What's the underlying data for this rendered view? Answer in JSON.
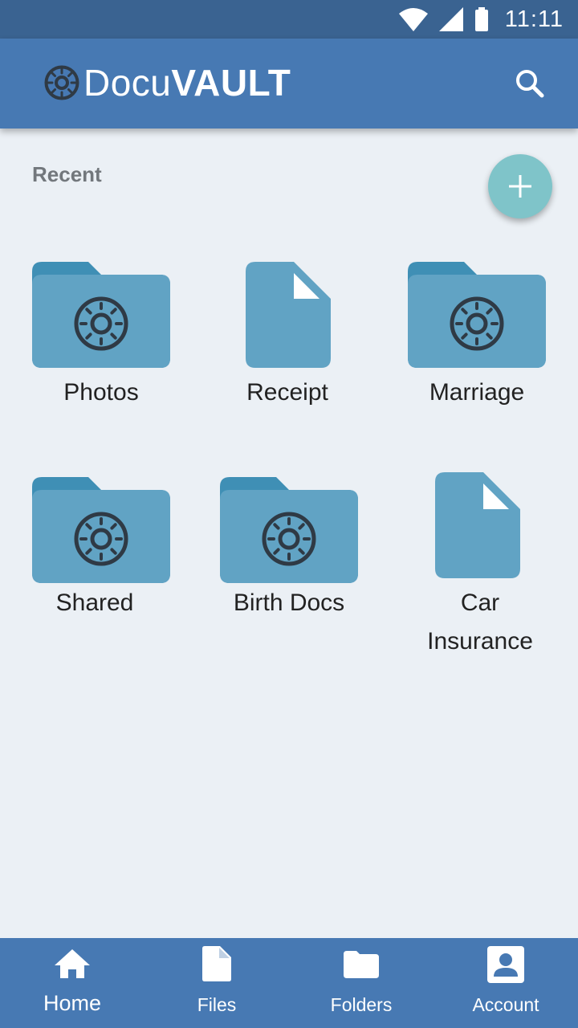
{
  "status_bar": {
    "time": "11:11",
    "icons": [
      "wifi-icon",
      "signal-icon",
      "battery-icon"
    ]
  },
  "app_bar": {
    "brand_light": "Docu",
    "brand_bold": "VAULT",
    "logo_icon": "vault-dial-icon",
    "search_icon": "search-icon"
  },
  "recent": {
    "title": "Recent",
    "items": [
      {
        "label": "Photos",
        "kind": "folder"
      },
      {
        "label": "Receipt",
        "kind": "file"
      },
      {
        "label": "Marriage",
        "kind": "folder"
      },
      {
        "label": "Shared",
        "kind": "folder"
      },
      {
        "label": "Birth Docs",
        "kind": "folder"
      },
      {
        "label_line1": "Car",
        "label_line2": "Insurance",
        "kind": "file"
      }
    ]
  },
  "fab": {
    "icon": "plus-icon"
  },
  "bottom_nav": {
    "items": [
      {
        "label": "Home",
        "icon": "home-icon",
        "active": true
      },
      {
        "label": "Files",
        "icon": "file-icon",
        "active": false
      },
      {
        "label": "Folders",
        "icon": "folder-icon",
        "active": false
      },
      {
        "label": "Account",
        "icon": "account-icon",
        "active": false
      }
    ]
  },
  "colors": {
    "status_bar": "#3a6391",
    "app_bar": "#4779b3",
    "background": "#ebf0f5",
    "item_fill": "#61a3c4",
    "folder_tab": "#3f8fb5",
    "fab": "#7fc4c9",
    "dial": "#2f3a45"
  }
}
